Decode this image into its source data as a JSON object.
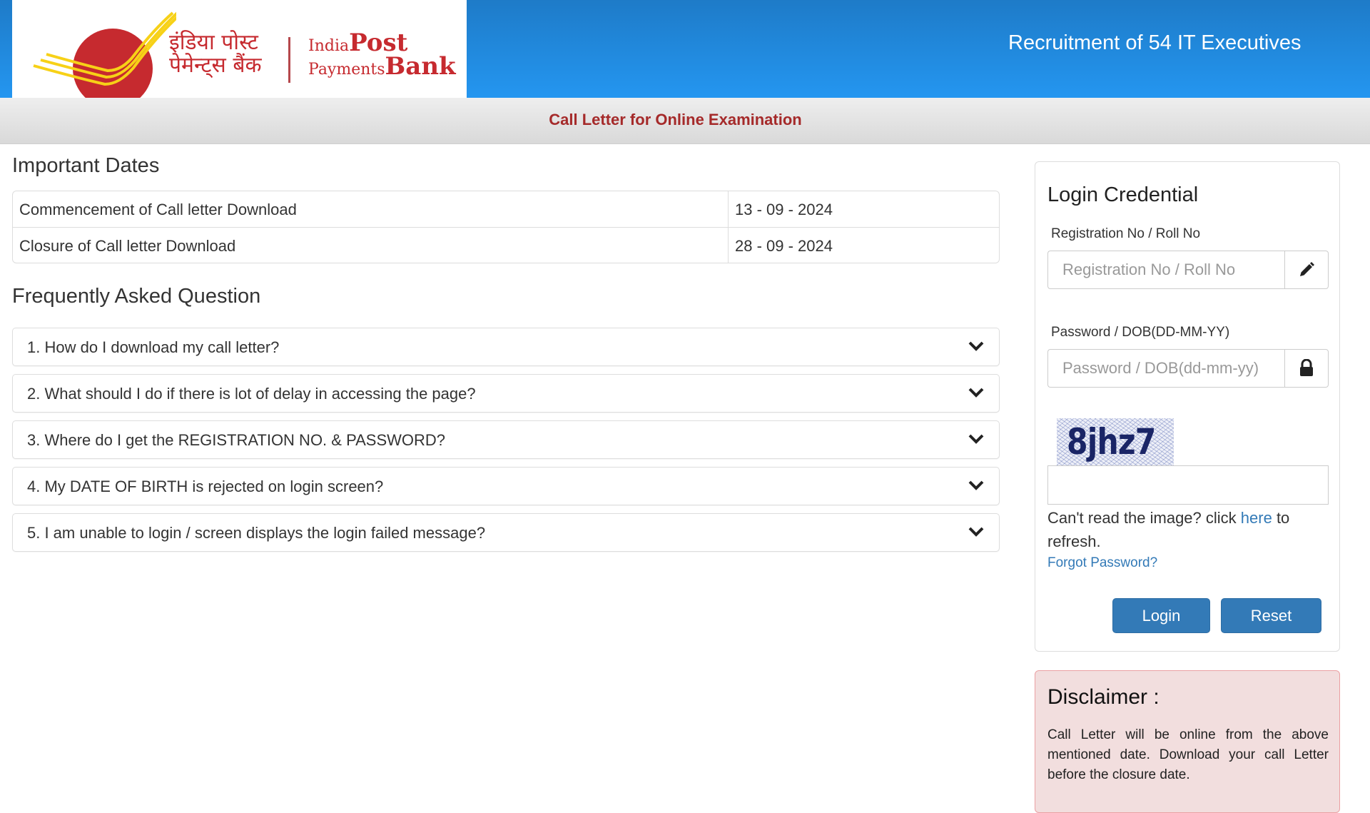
{
  "header": {
    "logo": {
      "hindi_line1": "इंडिया पोस्ट",
      "hindi_line2": "पेमेन्ट्स बैंक",
      "en_small1": "India",
      "en_big1": "Post",
      "en_small2": "Payments",
      "en_big2": "Bank"
    },
    "title": "Recruitment of 54 IT Executives"
  },
  "subheader": {
    "title": "Call Letter for Online Examination"
  },
  "important_dates": {
    "heading": "Important Dates",
    "rows": [
      {
        "label": "Commencement of Call letter Download",
        "value": "13 - 09 - 2024"
      },
      {
        "label": "Closure of Call letter Download",
        "value": "28 - 09 - 2024"
      }
    ]
  },
  "faq": {
    "heading": "Frequently Asked Question",
    "items": [
      {
        "question": "1. How do I download my call letter?"
      },
      {
        "question": "2. What should I do if there is lot of delay in accessing the page?"
      },
      {
        "question": "3. Where do I get the REGISTRATION NO. & PASSWORD?"
      },
      {
        "question": "4. My DATE OF BIRTH is rejected on login screen?"
      },
      {
        "question": "5. I am unable to login / screen displays the login failed message?"
      }
    ]
  },
  "login": {
    "title": "Login Credential",
    "registration": {
      "label": "Registration No / Roll No",
      "placeholder": "Registration No / Roll No",
      "value": "",
      "icon": "pencil-icon"
    },
    "password": {
      "label": "Password / DOB(DD-MM-YY)",
      "placeholder": "Password / DOB(dd-mm-yy)",
      "value": "",
      "icon": "lock-icon"
    },
    "captcha": {
      "text": "8jhz7",
      "input_value": ""
    },
    "refresh_prefix": "Can't read the image? click ",
    "refresh_link": "here",
    "refresh_suffix": " to refresh.",
    "forgot_password": "Forgot Password?",
    "login_button": "Login",
    "reset_button": "Reset"
  },
  "disclaimer": {
    "title": "Disclaimer :",
    "text": "Call Letter will be online from the above mentioned date. Download your call Letter before the closure date."
  },
  "colors": {
    "header_blue_top": "#1e7bc8",
    "header_blue_bottom": "#2496f0",
    "subheader_text": "#a52a2a",
    "logo_red": "#c62a2f",
    "logo_yellow": "#f7d117",
    "button_blue": "#337ab7",
    "link_blue": "#337ab7",
    "disclaimer_bg": "#f2dede"
  }
}
